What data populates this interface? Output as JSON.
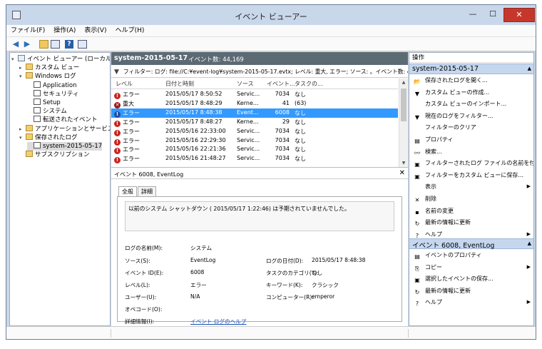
{
  "window": {
    "title": "イベント ビューアー",
    "min": "—",
    "max": "☐",
    "close": "✕"
  },
  "menu": [
    "ファイル(F)",
    "操作(A)",
    "表示(V)",
    "ヘルプ(H)"
  ],
  "toolbar": {
    "back": "◀",
    "fwd": "▶",
    "help": "?"
  },
  "tree": [
    {
      "label": "イベント ビューアー (ローカル)",
      "indent": 0,
      "exp": "▾",
      "icon": "computer"
    },
    {
      "label": "カスタム ビュー",
      "indent": 1,
      "exp": "▸",
      "icon": "folder"
    },
    {
      "label": "Windows ログ",
      "indent": 1,
      "exp": "▾",
      "icon": "folder"
    },
    {
      "label": "Application",
      "indent": 2,
      "exp": "",
      "icon": "log"
    },
    {
      "label": "セキュリティ",
      "indent": 2,
      "exp": "",
      "icon": "log"
    },
    {
      "label": "Setup",
      "indent": 2,
      "exp": "",
      "icon": "log"
    },
    {
      "label": "システム",
      "indent": 2,
      "exp": "",
      "icon": "log"
    },
    {
      "label": "転送されたイベント",
      "indent": 2,
      "exp": "",
      "icon": "log"
    },
    {
      "label": "アプリケーションとサービス ログ",
      "indent": 1,
      "exp": "▸",
      "icon": "folder"
    },
    {
      "label": "保存されたログ",
      "indent": 1,
      "exp": "▾",
      "icon": "folder"
    },
    {
      "label": "system-2015-05-17",
      "indent": 2,
      "exp": "",
      "icon": "log",
      "selected": true
    },
    {
      "label": "サブスクリプション",
      "indent": 1,
      "exp": "",
      "icon": "folder"
    }
  ],
  "log": {
    "name": "system-2015-05-17",
    "count": "イベント数: 44,169"
  },
  "filter": {
    "text": "フィルター: ログ: file://C:¥event-log¥system-2015-05-17.evtx; レベル: 重大, エラー; ソース: 。イベント数: 4,720"
  },
  "grid": {
    "headers": [
      "レベル",
      "日付と時刻",
      "ソース",
      "イベント...",
      "タスクの..."
    ],
    "rows": [
      {
        "level": "エラー",
        "type": "error",
        "datetime": "2015/05/17 8:50:52",
        "source": "Servic...",
        "id": "7034",
        "task": "なし"
      },
      {
        "level": "重大",
        "type": "critical",
        "datetime": "2015/05/17 8:48:29",
        "source": "Kerne...",
        "id": "41",
        "task": "(63)"
      },
      {
        "level": "エラー",
        "type": "error",
        "datetime": "2015/05/17 8:48:38",
        "source": "Event...",
        "id": "6008",
        "task": "なし",
        "selected": true
      },
      {
        "level": "エラー",
        "type": "error",
        "datetime": "2015/05/17 8:48:27",
        "source": "Kerne...",
        "id": "29",
        "task": "なし"
      },
      {
        "level": "エラー",
        "type": "error",
        "datetime": "2015/05/16 22:33:00",
        "source": "Servic...",
        "id": "7034",
        "task": "なし"
      },
      {
        "level": "エラー",
        "type": "error",
        "datetime": "2015/05/16 22:29:30",
        "source": "Servic...",
        "id": "7034",
        "task": "なし"
      },
      {
        "level": "エラー",
        "type": "error",
        "datetime": "2015/05/16 22:21:36",
        "source": "Servic...",
        "id": "7034",
        "task": "なし"
      },
      {
        "level": "エラー",
        "type": "error",
        "datetime": "2015/05/16 21:48:27",
        "source": "Servic...",
        "id": "7034",
        "task": "なし"
      }
    ]
  },
  "detail": {
    "title": "イベント 6008, EventLog",
    "close": "✕",
    "tabs": [
      "全般",
      "詳細"
    ],
    "message": "以前のシステム シャットダウン ( 2015/05/17 1:22:46) は予期されていませんでした。",
    "props": {
      "logname_l": "ログの名前(M):",
      "logname_v": "システム",
      "source_l": "ソース(S):",
      "source_v": "EventLog",
      "logged_l": "ログの日付(D):",
      "logged_v": "2015/05/17 8:48:38",
      "eventid_l": "イベント ID(E):",
      "eventid_v": "6008",
      "task_l": "タスクのカテゴリ(Y):",
      "task_v": "なし",
      "level_l": "レベル(L):",
      "level_v": "エラー",
      "keywords_l": "キーワード(K):",
      "keywords_v": "クラシック",
      "user_l": "ユーザー(U):",
      "user_v": "N/A",
      "computer_l": "コンピューター(R):",
      "computer_v": "emperor",
      "opcode_l": "オペコード(O):",
      "opcode_v": "",
      "more_l": "詳細情報(I):",
      "more_v": "イベント ログのヘルプ"
    }
  },
  "actions": {
    "header": "操作",
    "section1": "system-2015-05-17",
    "items1": [
      {
        "label": "保存されたログを開く...",
        "icon": "📂"
      },
      {
        "label": "カスタム ビューの作成...",
        "icon": "▼"
      },
      {
        "label": "カスタム ビューのインポート...",
        "icon": ""
      },
      {
        "label": "現在のログをフィルター...",
        "icon": "▼"
      },
      {
        "label": "フィルターのクリア",
        "icon": ""
      },
      {
        "label": "プロパティ",
        "icon": "▤"
      },
      {
        "label": "検索...",
        "icon": "👓"
      },
      {
        "label": "フィルターされたログ ファイルの名前を付...",
        "icon": "▣"
      },
      {
        "label": "フィルターをカスタム ビューに保存...",
        "icon": "▣"
      },
      {
        "label": "表示",
        "icon": "",
        "sub": "▶"
      },
      {
        "label": "削除",
        "icon": "✕"
      },
      {
        "label": "名前の変更",
        "icon": "▪"
      },
      {
        "label": "最新の情報に更新",
        "icon": "↻"
      },
      {
        "label": "ヘルプ",
        "icon": "?",
        "sub": "▶"
      }
    ],
    "section2": "イベント 6008, EventLog",
    "items2": [
      {
        "label": "イベントのプロパティ",
        "icon": "▤"
      },
      {
        "label": "コピー",
        "icon": "⎘",
        "sub": "▶"
      },
      {
        "label": "選択したイベントの保存...",
        "icon": "▣"
      },
      {
        "label": "最新の情報に更新",
        "icon": "↻"
      },
      {
        "label": "ヘルプ",
        "icon": "?",
        "sub": "▶"
      }
    ],
    "caret": "▲"
  }
}
